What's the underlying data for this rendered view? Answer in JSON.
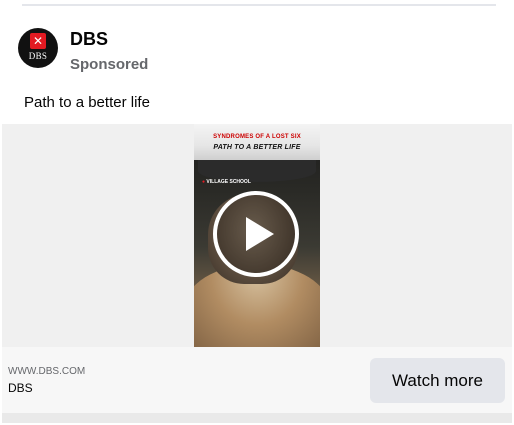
{
  "post": {
    "page_name": "DBS",
    "sponsored_label": "Sponsored",
    "caption": "Path to a better life",
    "avatar": {
      "logo_mark": "✕",
      "logo_text": "DBS"
    }
  },
  "video": {
    "thumb_line1": "SYNDROMES OF A LOST SIX",
    "thumb_title": "PATH TO A BETTER LIFE",
    "thumb_location": "VILLAGE SCHOOL",
    "play_icon": "play-icon"
  },
  "link": {
    "domain": "WWW.DBS.COM",
    "brand": "DBS",
    "cta_label": "Watch more"
  },
  "colors": {
    "brand_red": "#e31a22",
    "cta_bg": "#e4e6eb",
    "secondary_text": "#65676b"
  }
}
